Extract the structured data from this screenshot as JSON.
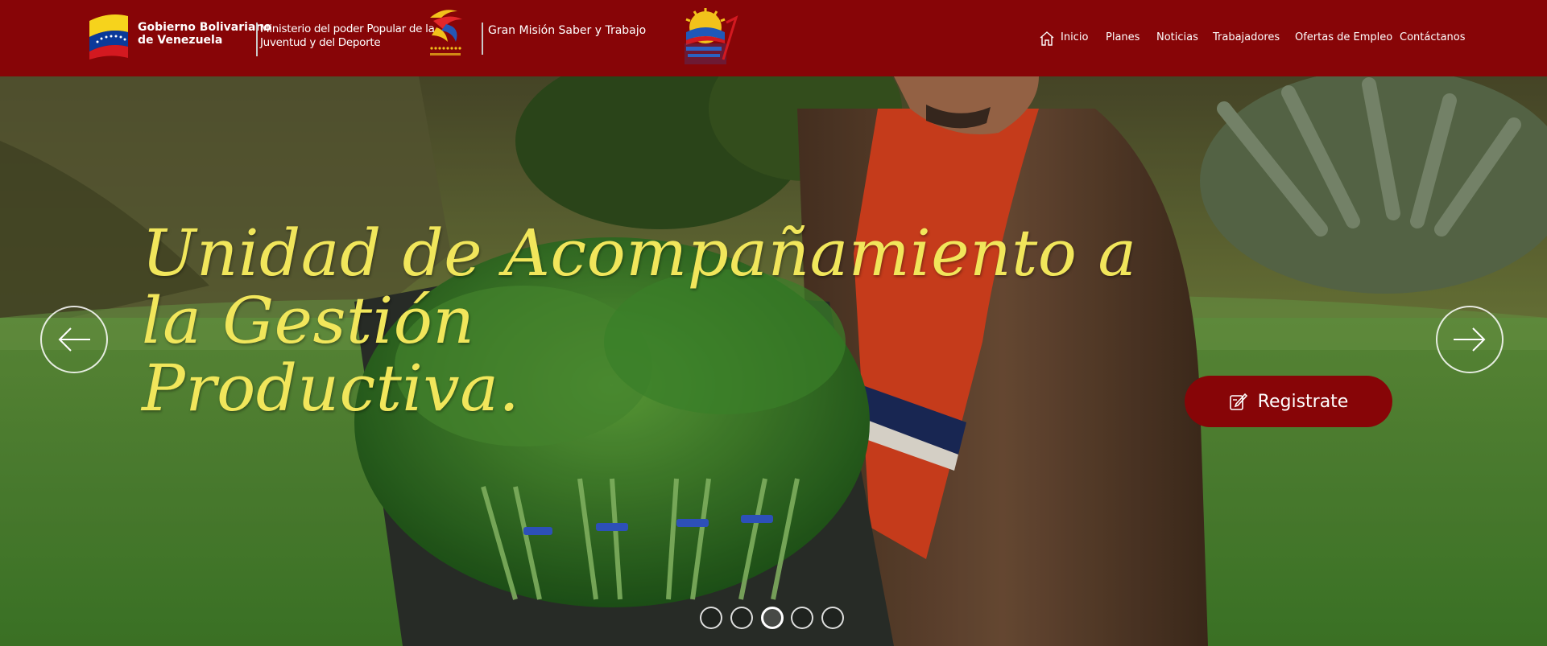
{
  "header": {
    "gov_line1": "Gobierno Bolivariano",
    "gov_line2": "de Venezuela",
    "ministry_line1": "Ministerio del poder Popular de la",
    "ministry_line2": "Juventud y del Deporte",
    "mission_name": "Gran Misión Saber y Trabajo",
    "flag_icon": "venezuela-flag-icon",
    "ministry_logo": "ministry-juventud-logo",
    "mission_logo": "gran-mision-logo",
    "colors": {
      "bar": "#870507",
      "text": "#ffffff"
    }
  },
  "nav": {
    "items": [
      {
        "label": "Inicio",
        "icon": "home-icon"
      },
      {
        "label": "Planes"
      },
      {
        "label": "Noticias"
      },
      {
        "label": "Trabajadores"
      },
      {
        "label": "Ofertas de Empleo"
      },
      {
        "label": "Contáctanos"
      }
    ]
  },
  "hero": {
    "headline_line1": "Unidad de Acompañamiento a la Gestión",
    "headline_line2": "Productiva.",
    "headline_color": "#f1e65b",
    "register_label": "Registrate",
    "register_icon": "edit-icon",
    "prev_icon": "arrow-left-icon",
    "next_icon": "arrow-right-icon",
    "slide_count": 5,
    "active_slide": 3
  }
}
